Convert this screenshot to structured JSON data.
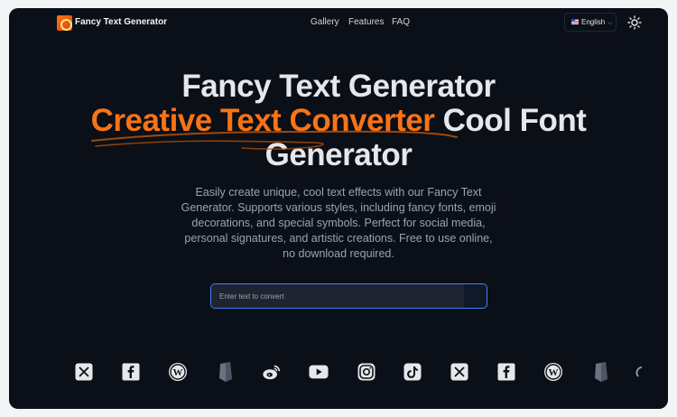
{
  "header": {
    "brand": "Fancy Text Generator",
    "nav": [
      "Gallery",
      "Features",
      "FAQ"
    ],
    "language": "English"
  },
  "hero": {
    "title_line1": "Fancy Text Generator",
    "title_accent": "Creative Text Converter",
    "title_rest": " Cool Font",
    "title_line3": "Generator",
    "description": "Easily create unique, cool text effects with our Fancy Text Generator. Supports various styles, including fancy fonts, emoji decorations, and special symbols. Perfect for social media, personal signatures, and artistic creations. Free to use online, no download required."
  },
  "input": {
    "placeholder": "Enter text to convert",
    "value": ""
  },
  "social_icons": [
    "x-icon",
    "facebook-icon",
    "wordpress-icon",
    "medium-icon",
    "weibo-icon",
    "youtube-icon",
    "instagram-icon",
    "tiktok-icon",
    "x-icon",
    "facebook-icon",
    "wordpress-icon",
    "medium-icon"
  ],
  "colors": {
    "background": "#0b0f17",
    "accent": "#f97316",
    "input_border": "#3b82f6"
  }
}
